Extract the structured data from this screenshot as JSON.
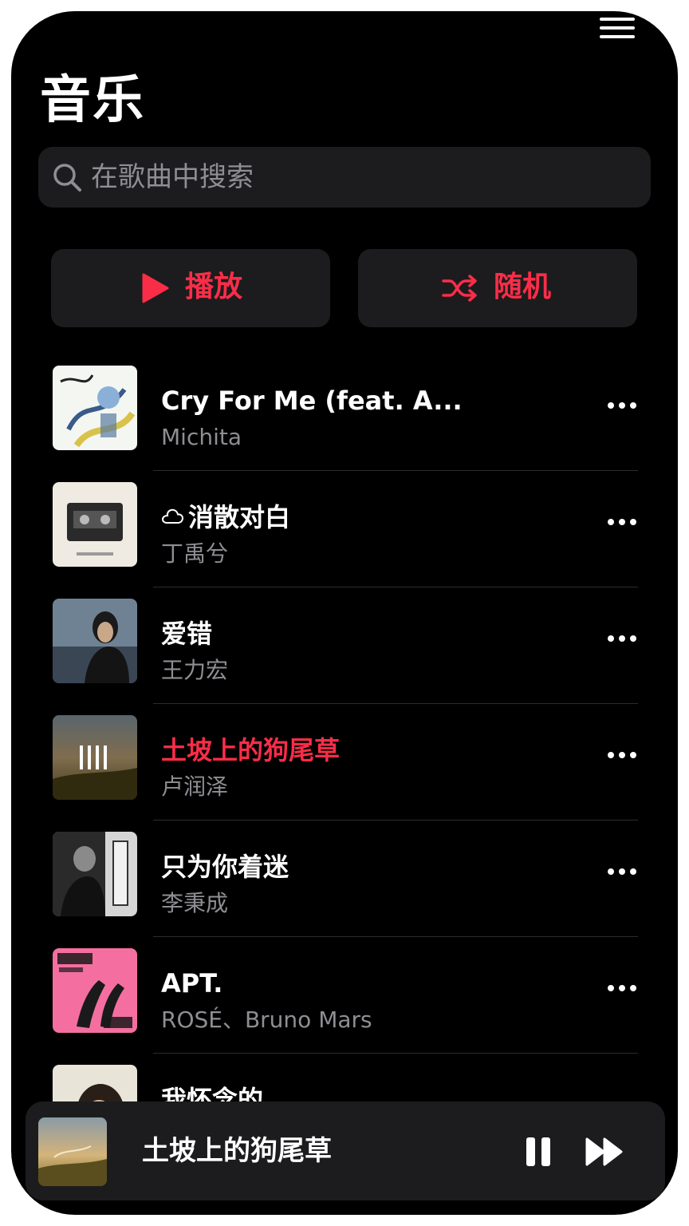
{
  "header": {
    "title": "音乐"
  },
  "search": {
    "placeholder": "在歌曲中搜索"
  },
  "actions": {
    "play_label": "播放",
    "shuffle_label": "随机"
  },
  "songs": [
    {
      "title": "Cry For Me (feat. A...",
      "artist": "Michita",
      "cloud": false,
      "playing": false
    },
    {
      "title": "消散对白",
      "artist": "丁禹兮",
      "cloud": true,
      "playing": false
    },
    {
      "title": "爱错",
      "artist": "王力宏",
      "cloud": false,
      "playing": false
    },
    {
      "title": "土坡上的狗尾草",
      "artist": "卢润泽",
      "cloud": false,
      "playing": true
    },
    {
      "title": "只为你着迷",
      "artist": "李秉成",
      "cloud": false,
      "playing": false
    },
    {
      "title": "APT.",
      "artist": "ROSÉ、Bruno Mars",
      "cloud": false,
      "playing": false
    },
    {
      "title": "我怀念的",
      "artist": "",
      "cloud": false,
      "playing": false
    }
  ],
  "now_playing": {
    "title": "土坡上的狗尾草"
  },
  "icons": {
    "menu": "hamburger-icon",
    "search": "search-icon",
    "play": "play-icon",
    "shuffle": "shuffle-icon",
    "more": "ellipsis-icon",
    "cloud": "cloud-icon",
    "pause": "pause-icon",
    "next": "forward-icon",
    "playing": "equalizer-icon"
  },
  "colors": {
    "accent": "#fa2d48",
    "background": "#000000",
    "surface": "#1c1c1e",
    "secondary_text": "#8e8e93"
  }
}
